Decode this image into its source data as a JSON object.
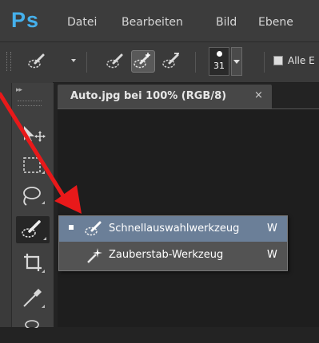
{
  "app": {
    "logo": "Ps"
  },
  "menubar": {
    "items": [
      "Datei",
      "Bearbeiten",
      "Bild",
      "Ebene"
    ]
  },
  "options": {
    "brush_size": "31",
    "checkbox_label": "Alle E"
  },
  "document": {
    "tab_title": "Auto.jpg bei 100% (RGB/8)",
    "close_glyph": "×"
  },
  "toolbar": {
    "collapse_glyph": "▸▸"
  },
  "flyout": {
    "items": [
      {
        "label": "Schnellauswahlwerkzeug",
        "shortcut": "W",
        "selected": true
      },
      {
        "label": "Zauberstab-Werkzeug",
        "shortcut": "W",
        "selected": false
      }
    ]
  },
  "colors": {
    "accent": "#45b0ec",
    "highlight": "#6b7f98",
    "arrow": "#e8191a"
  }
}
